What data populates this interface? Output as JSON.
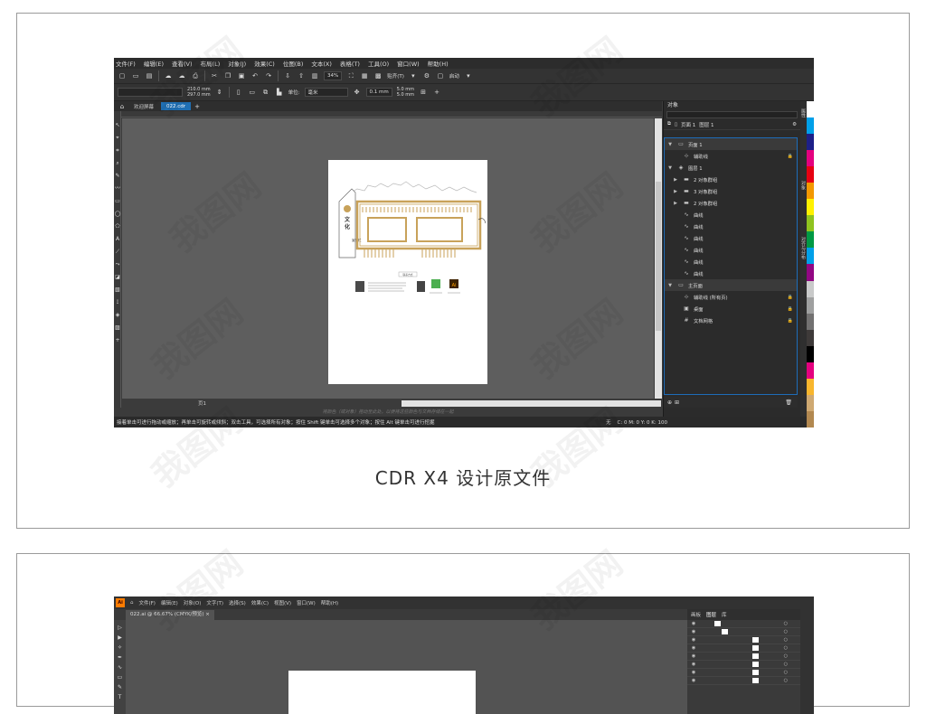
{
  "caption": "CDR X4 设计原文件",
  "cdr": {
    "menu": [
      "文件(F)",
      "编辑(E)",
      "查看(V)",
      "布局(L)",
      "对象(J)",
      "效果(C)",
      "位图(B)",
      "文本(X)",
      "表格(T)",
      "工具(O)",
      "窗口(W)",
      "帮助(H)"
    ],
    "toolbar1": {
      "zoom": "34%",
      "snap_label": "贴齐(T)",
      "launch_label": "启动"
    },
    "toolbar2": {
      "width": "210.0 mm",
      "height": "297.0 mm",
      "units_label": "单位:",
      "units_value": "毫米",
      "nudge": "0.1 mm",
      "dup_x": "5.0 mm",
      "dup_y": "5.0 mm"
    },
    "tabs": [
      "欢迎屏幕",
      "022.cdr"
    ],
    "page_tab": "页1",
    "hint": "将颜色（或对象）拖动至此处，以便将这些颜色与文档存储在一起",
    "status": "接着单击可进行拖动或缩放；再单击可旋转或倾斜；双击工具，可选择所有对象；按住 Shift 键单击可选择多个对象；按住 Alt 键单击可进行挖掘",
    "status_right": "无",
    "status_cmyk": "C: 0 M: 0 Y: 0 K: 100",
    "docker": {
      "title": "对象",
      "page_label": "页面 1",
      "layer_label": "图层 1",
      "rows": [
        {
          "indent": 0,
          "twisty": "▼",
          "icon": "page",
          "label": "页面 1",
          "right": "",
          "group": true
        },
        {
          "indent": 1,
          "twisty": "",
          "icon": "guides",
          "label": "辅助线",
          "right": "lock",
          "group": false
        },
        {
          "indent": 0,
          "twisty": "▼",
          "icon": "layer",
          "label": "图层 1",
          "right": "",
          "group": false
        },
        {
          "indent": 1,
          "twisty": "▶",
          "icon": "group",
          "label": "2 对象群组",
          "right": "",
          "group": false
        },
        {
          "indent": 1,
          "twisty": "▶",
          "icon": "group",
          "label": "3 对象群组",
          "right": "",
          "group": false
        },
        {
          "indent": 1,
          "twisty": "▶",
          "icon": "group",
          "label": "2 对象群组",
          "right": "",
          "group": false
        },
        {
          "indent": 1,
          "twisty": "",
          "icon": "curve",
          "label": "曲线",
          "right": "",
          "group": false
        },
        {
          "indent": 1,
          "twisty": "",
          "icon": "curve",
          "label": "曲线",
          "right": "",
          "group": false
        },
        {
          "indent": 1,
          "twisty": "",
          "icon": "curve",
          "label": "曲线",
          "right": "",
          "group": false
        },
        {
          "indent": 1,
          "twisty": "",
          "icon": "curve",
          "label": "曲线",
          "right": "",
          "group": false
        },
        {
          "indent": 1,
          "twisty": "",
          "icon": "curve",
          "label": "曲线",
          "right": "",
          "group": false
        },
        {
          "indent": 1,
          "twisty": "",
          "icon": "curve",
          "label": "曲线",
          "right": "",
          "group": false
        },
        {
          "indent": 0,
          "twisty": "▼",
          "icon": "page",
          "label": "主页面",
          "right": "",
          "group": true
        },
        {
          "indent": 1,
          "twisty": "",
          "icon": "guides",
          "label": "辅助线 (所有页)",
          "right": "lock",
          "group": false
        },
        {
          "indent": 1,
          "twisty": "",
          "icon": "desktop",
          "label": "桌面",
          "right": "lock",
          "group": false
        },
        {
          "indent": 1,
          "twisty": "",
          "icon": "grid",
          "label": "文档网格",
          "right": "lock",
          "group": false
        }
      ]
    },
    "side_tabs": [
      "属性",
      "对象",
      "对齐与分布"
    ],
    "palette": [
      "#ffffff",
      "#00a0e9",
      "#1d2088",
      "#e4007f",
      "#e60012",
      "#f39800",
      "#fff100",
      "#8fc31f",
      "#009944",
      "#00a0e9",
      "#920783",
      "#c9caca",
      "#9fa0a0",
      "#727171",
      "#3e3a39",
      "#000000",
      "#e4007f",
      "#f8b62d",
      "#cfa972",
      "#b28850"
    ]
  },
  "artwork": {
    "vertical_title": "文化",
    "vertical_sub": "宣传栏",
    "cta_small": "联系方式",
    "ai_badge": "Ai",
    "gold": "#c8a25a",
    "dark": "#333333"
  },
  "ai": {
    "menu": [
      "文件(F)",
      "编辑(E)",
      "对象(O)",
      "文字(T)",
      "选择(S)",
      "效果(C)",
      "视图(V)",
      "窗口(W)",
      "帮助(H)"
    ],
    "logo": "Ai",
    "doc_tab": "022.ai @ 66.67% (CMYK/预览)",
    "panel_tabs": [
      "画板",
      "图层",
      "库"
    ],
    "layer_count": 8
  },
  "watermark": "我图网"
}
